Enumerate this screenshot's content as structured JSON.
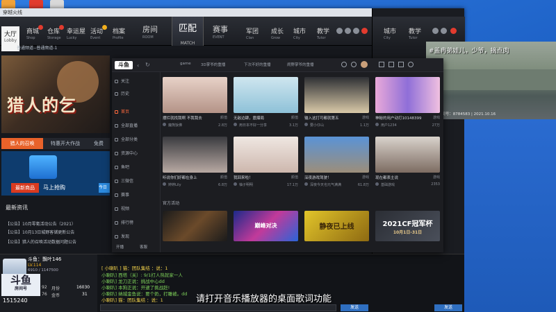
{
  "lobby": {
    "window_title": "穿越火线",
    "nav": {
      "hall": {
        "label": "大厅",
        "sub": "Lobby"
      },
      "items": [
        {
          "label": "商城",
          "sub": "Shop"
        },
        {
          "label": "仓库",
          "sub": "Storage"
        },
        {
          "label": "幸运屋",
          "sub": "Lucky"
        },
        {
          "label": "活动",
          "sub": "Event"
        },
        {
          "label": "档案",
          "sub": "Profile"
        },
        {
          "label": "房间",
          "sub": "ROOM"
        }
      ],
      "match": {
        "label": "匹配",
        "sub": "MATCH"
      },
      "right_items": [
        {
          "label": "赛事",
          "sub": "EVENT"
        },
        {
          "label": "军团",
          "sub": "Clan"
        },
        {
          "label": "成长",
          "sub": "Grow"
        },
        {
          "label": "城市",
          "sub": "City"
        },
        {
          "label": "教学",
          "sub": "Tutor"
        }
      ]
    },
    "notice": "普通频道--普通频道-1",
    "hero_title": "猎人的乞",
    "tabs": [
      "猎人的召唤",
      "特惠开大作战",
      "免费"
    ],
    "promo": {
      "new_goods": "最新商品",
      "buy_now": "马上抢购",
      "today": "今日"
    },
    "news_title": "最新资讯",
    "news": [
      "【公告】10月零氪活动公告（2021）",
      "【公告】10月13日城野客储更新公告",
      "【公告】猎人的召唤活动数据问题公告"
    ],
    "profile": {
      "name": "斗鱼：飘叶146",
      "level": "LV.114",
      "exp": "6910 / 1147500",
      "logo": "斗鱼",
      "logo_sub": "房间号",
      "stat1_label": "92",
      "stat2_label": "月份",
      "stat2_value": "16030",
      "stat3_label": "76",
      "stat4_label": "金币",
      "stat4_value": "31",
      "coins": "1515240"
    },
    "chat": {
      "lines": [
        "[ 小喇叭 ] 猫：团队集结 ：说：1",
        "小喇叭] 西塔（关）: 9/1打人热就家一人",
        "小喇叭] 龙刀正说：挑战中心dd",
        "小喇叭] 本狗正说：开逮了挑战赶!",
        "小喇叭] 纳城金鱼说：要个奶，打雕被。dd",
        "小喇叭] 猫：团队集结 ：说：1"
      ],
      "send": "发送"
    }
  },
  "subtitle": "请打开音乐播放器的桌面歌词功能",
  "stream": {
    "overlay": "#盖冉弟娃儿，少爷，摘点肉",
    "caption": "斗鱼 房间号：8784583 | 2021.10.16"
  },
  "platform": {
    "logo": "斗鱼",
    "top_tabs": [
      "game",
      "3D掌爷的重播",
      "下次不好的重播",
      "闹野掌爷的重播"
    ],
    "sidebar": [
      {
        "label": "关注",
        "active": false
      },
      {
        "label": "历史",
        "active": false
      },
      {
        "label": "首页",
        "active": true
      },
      {
        "label": "全部直播",
        "active": false
      },
      {
        "label": "全部分类",
        "active": false
      },
      {
        "label": "资源中心",
        "active": false
      },
      {
        "label": "鱼吧",
        "active": false
      },
      {
        "label": "三微信",
        "active": false
      },
      {
        "label": "赛事",
        "active": false
      },
      {
        "label": "视频",
        "active": false
      },
      {
        "label": "排行榜",
        "active": false
      },
      {
        "label": "发现",
        "active": false
      }
    ],
    "sidebar_bottom": [
      "开播",
      "客服"
    ],
    "cards": [
      {
        "title": "摆烂就找我啊 不我我去",
        "tag": "颜值",
        "streamer": "魔熊饭佛",
        "heat": "2.8万"
      },
      {
        "title": "无敌边肆，震爆局",
        "tag": "颜值",
        "streamer": "用日本不好一分享",
        "heat": "3.1万"
      },
      {
        "title": "输入这打可都就第五",
        "tag": "游戏",
        "streamer": "要小仔山",
        "heat": "1.1万"
      },
      {
        "title": "神秘的用户动打10148399",
        "tag": "游戏",
        "streamer": "用户1234",
        "heat": "27万"
      },
      {
        "title": "听说你们好都在身上",
        "tag": "颜值",
        "streamer": "婷婷Lily",
        "heat": "6.8万"
      },
      {
        "title": "我回来啦！",
        "tag": "颜值",
        "streamer": "柚子明明",
        "heat": "17.1万"
      },
      {
        "title": "深夜游戏驾驶！",
        "tag": "游戏",
        "streamer": "深夜今天也元气满满",
        "heat": "61.8万"
      },
      {
        "title": "现在都表主说",
        "tag": "游戏",
        "streamer": "基础游戏",
        "heat": "2353"
      }
    ],
    "official_label": "官方活动",
    "official": [
      {
        "text": ""
      },
      {
        "text": "巅峰对决"
      },
      {
        "text": "静夜已上线"
      },
      {
        "text": "2021CF冠军杯",
        "sub": "10月1日-31日"
      }
    ]
  },
  "colors": {
    "accent": "#ff6a3d",
    "desktop": "#2a6fd6",
    "panel": "#1c1d21",
    "chat_green": "#7fd35a"
  }
}
